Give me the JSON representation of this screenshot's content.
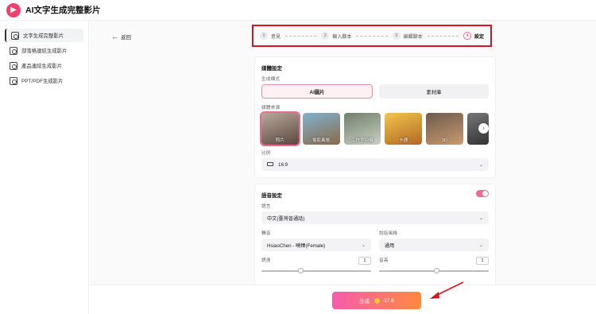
{
  "app": {
    "title": "AI文字生成完整影片",
    "logo_icon": "film-icon"
  },
  "sidebar": {
    "items": [
      {
        "label": "文字生成完整影片",
        "icon": "video-icon",
        "active": true
      },
      {
        "label": "部落格連結生成影片",
        "icon": "link-icon",
        "active": false
      },
      {
        "label": "產品連結生成影片",
        "icon": "cart-icon",
        "active": false
      },
      {
        "label": "PPT/PDF生成影片",
        "icon": "slides-icon",
        "active": false
      }
    ]
  },
  "back": {
    "label": "返回"
  },
  "stepper": {
    "steps": [
      {
        "num": "1",
        "label": "意見"
      },
      {
        "num": "2",
        "label": "輸入腳本"
      },
      {
        "num": "3",
        "label": "編輯腳本"
      },
      {
        "num": "4",
        "label": "設定"
      }
    ],
    "current": 3
  },
  "media_settings": {
    "title": "媒體設定",
    "mode_label": "生成模式",
    "modes": [
      {
        "label": "AI圖片",
        "active": true
      },
      {
        "label": "素材庫",
        "active": false
      }
    ],
    "source_label": "媒體來源",
    "sources": [
      {
        "label": "照片",
        "color": "#6b5a52"
      },
      {
        "label": "電影風格",
        "color": "#3f6f8f"
      },
      {
        "label": "工作室拍攝",
        "color": "#9aa89c"
      },
      {
        "label": "卡通",
        "color": "#d39b35"
      },
      {
        "label": "3D",
        "color": "#8c6a55"
      },
      {
        "label": "",
        "color": "#5b5b5b"
      }
    ],
    "ratio_label": "比例",
    "ratio_value": "16:9"
  },
  "voice_settings": {
    "title": "語音設定",
    "enabled": true,
    "language_label": "語言",
    "language_value": "中文(臺灣普通話)",
    "voice_label": "聲音",
    "voice_value": "HsiaoChen - 曉臻(Female)",
    "style_label": "說話風格",
    "style_value": "通用",
    "speed_label": "語速",
    "speed_value": "1",
    "speed_level": 0.33,
    "volume_label": "音高",
    "volume_value": "1",
    "volume_level": 0.5
  },
  "generate": {
    "label": "生成",
    "cost": "-17.6"
  }
}
